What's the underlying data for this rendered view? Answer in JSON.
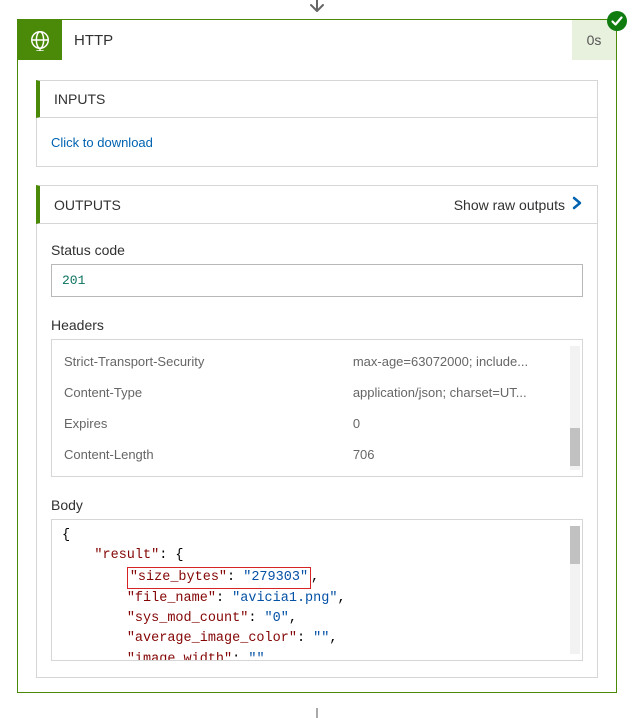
{
  "arrow_top_glyph": "↓",
  "header": {
    "title": "HTTP",
    "duration": "0s",
    "icon": "globe-network-icon",
    "status": "success"
  },
  "inputs": {
    "label": "INPUTS",
    "download_link": "Click to download"
  },
  "outputs": {
    "label": "OUTPUTS",
    "raw_link": "Show raw outputs",
    "status_code_label": "Status code",
    "status_code_value": "201",
    "headers_label": "Headers",
    "headers": [
      {
        "k": "Strict-Transport-Security",
        "v": "max-age=63072000; include..."
      },
      {
        "k": "Content-Type",
        "v": "application/json; charset=UT..."
      },
      {
        "k": "Expires",
        "v": "0"
      },
      {
        "k": "Content-Length",
        "v": "706"
      }
    ],
    "body_label": "Body",
    "body_lines": [
      {
        "indent": 0,
        "segs": [
          {
            "t": "{",
            "c": "jpunc"
          }
        ]
      },
      {
        "indent": 1,
        "segs": [
          {
            "t": "\"result\"",
            "c": "jkey"
          },
          {
            "t": ": {",
            "c": "jpunc"
          }
        ]
      },
      {
        "indent": 2,
        "hilite": true,
        "segs": [
          {
            "t": "\"size_bytes\"",
            "c": "jkey"
          },
          {
            "t": ": ",
            "c": "jpunc"
          },
          {
            "t": "\"279303\"",
            "c": "jstr"
          },
          {
            "t": ",",
            "c": "jpunc",
            "outside": true
          }
        ]
      },
      {
        "indent": 2,
        "segs": [
          {
            "t": "\"file_name\"",
            "c": "jkey"
          },
          {
            "t": ": ",
            "c": "jpunc"
          },
          {
            "t": "\"avicia1.png\"",
            "c": "jstr"
          },
          {
            "t": ",",
            "c": "jpunc"
          }
        ]
      },
      {
        "indent": 2,
        "segs": [
          {
            "t": "\"sys_mod_count\"",
            "c": "jkey"
          },
          {
            "t": ": ",
            "c": "jpunc"
          },
          {
            "t": "\"0\"",
            "c": "jstr"
          },
          {
            "t": ",",
            "c": "jpunc"
          }
        ]
      },
      {
        "indent": 2,
        "segs": [
          {
            "t": "\"average_image_color\"",
            "c": "jkey"
          },
          {
            "t": ": ",
            "c": "jpunc"
          },
          {
            "t": "\"\"",
            "c": "jstr"
          },
          {
            "t": ",",
            "c": "jpunc"
          }
        ]
      },
      {
        "indent": 2,
        "segs": [
          {
            "t": "\"image_width\"",
            "c": "jkey"
          },
          {
            "t": ": ",
            "c": "jpunc"
          },
          {
            "t": "\"\"",
            "c": "jstr"
          },
          {
            "t": ",",
            "c": "jpunc"
          }
        ]
      }
    ]
  }
}
